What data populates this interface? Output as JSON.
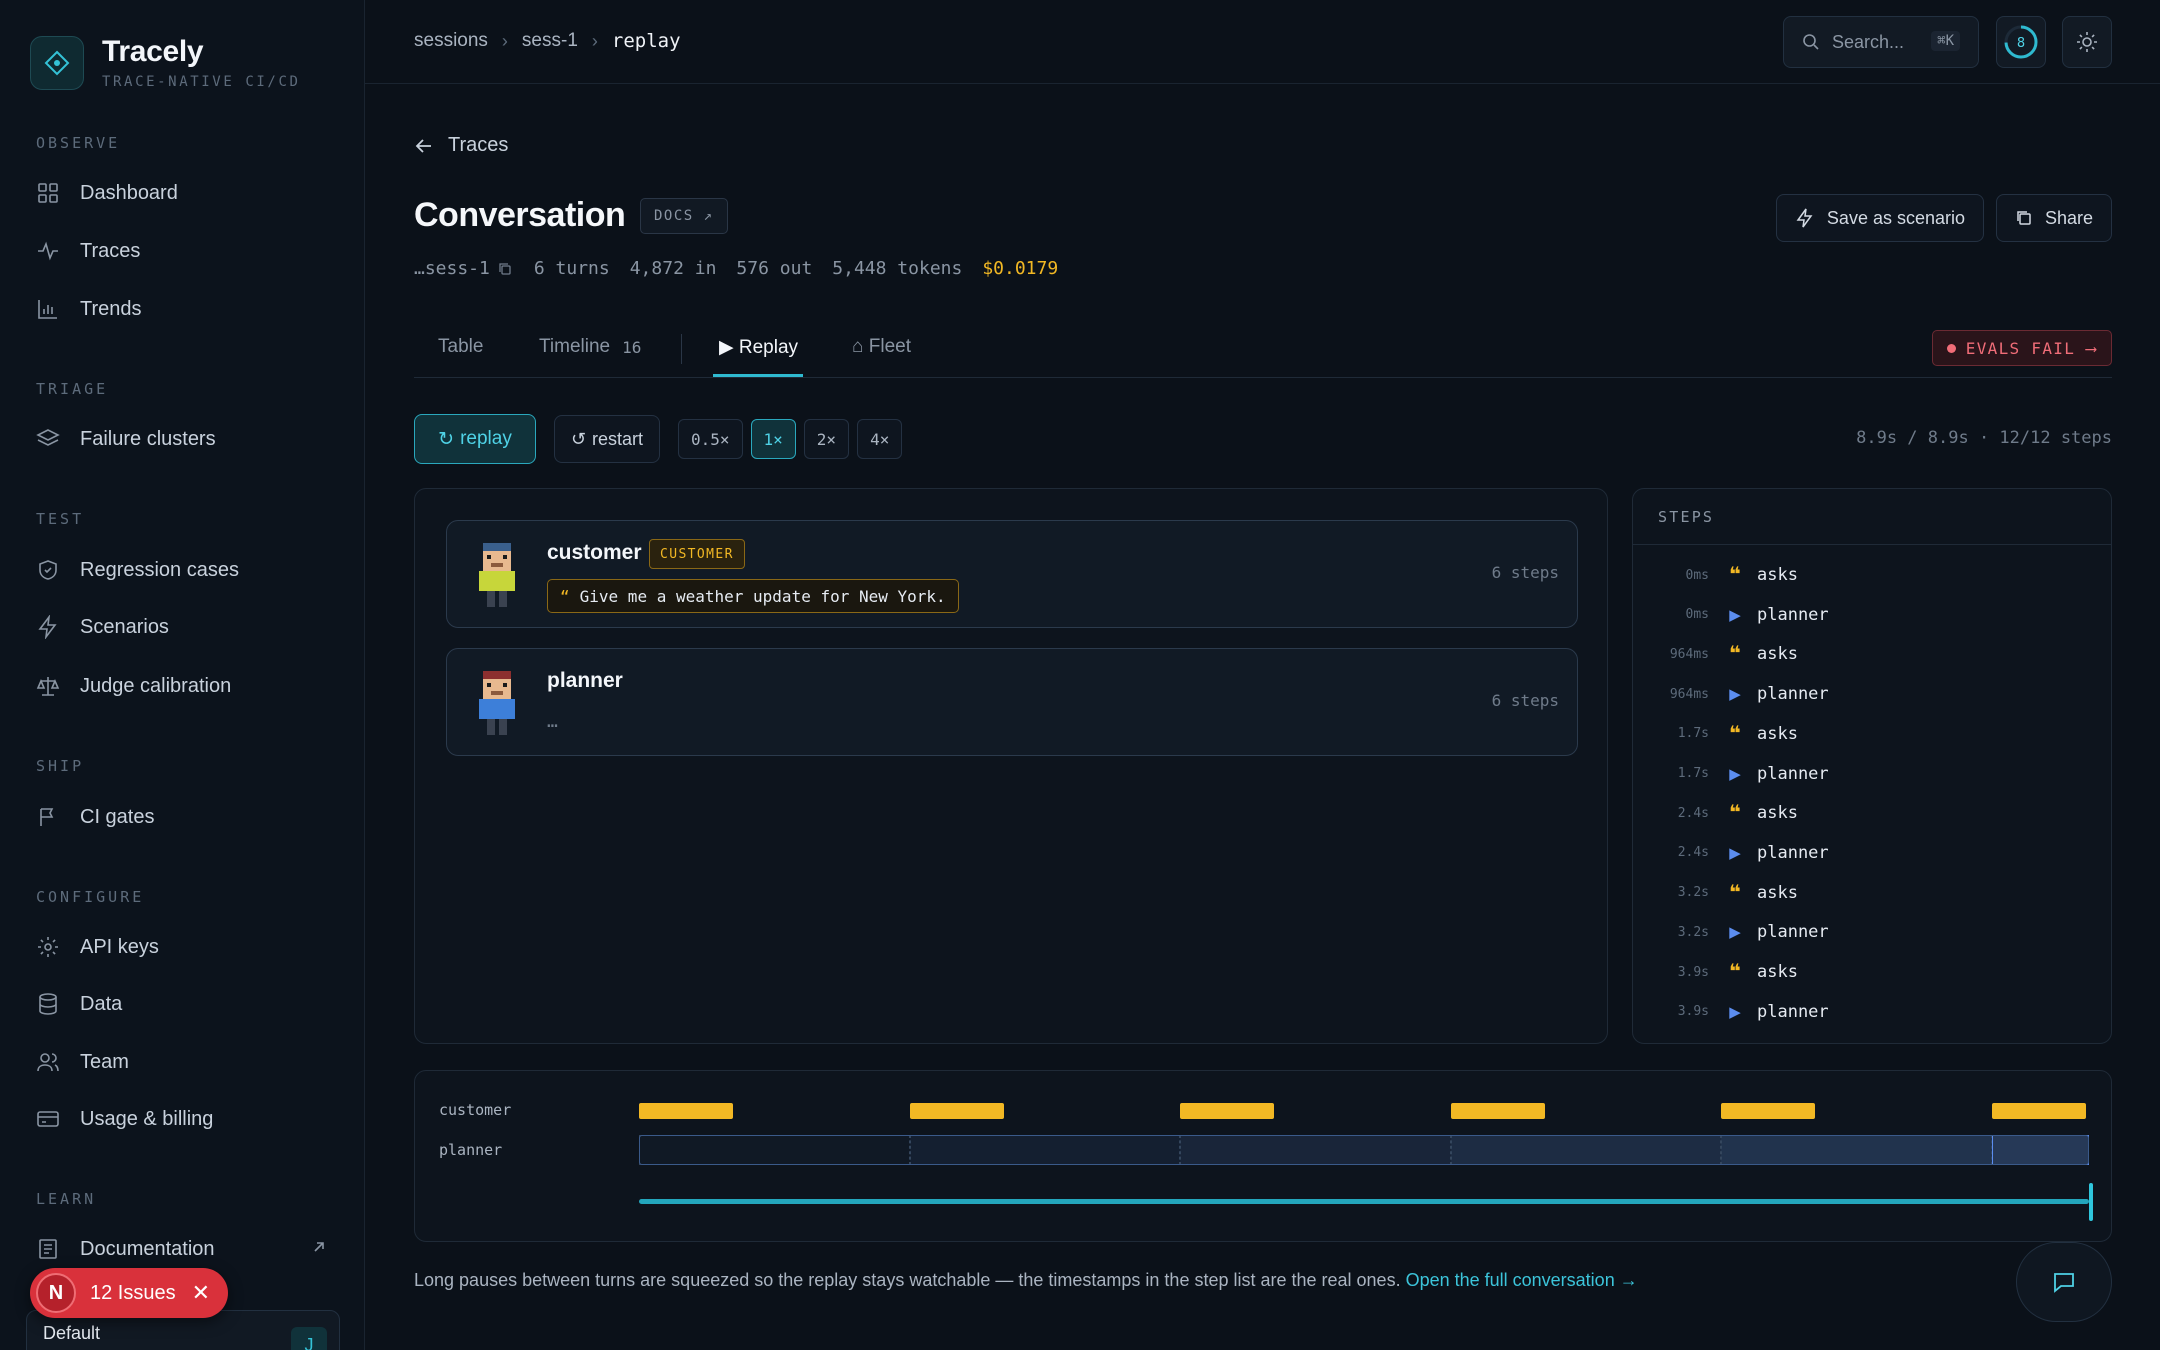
{
  "brand": {
    "name": "Tracely",
    "tagline": "TRACE-NATIVE CI/CD"
  },
  "sidebar": {
    "sections": [
      {
        "label": "OBSERVE",
        "items": [
          {
            "label": "Dashboard",
            "icon": "grid-icon"
          },
          {
            "label": "Traces",
            "icon": "pulse-icon"
          },
          {
            "label": "Trends",
            "icon": "bar-chart-icon"
          }
        ]
      },
      {
        "label": "TRIAGE",
        "items": [
          {
            "label": "Failure clusters",
            "icon": "layers-icon"
          }
        ]
      },
      {
        "label": "TEST",
        "items": [
          {
            "label": "Regression cases",
            "icon": "shield-check-icon"
          },
          {
            "label": "Scenarios",
            "icon": "bolt-icon"
          },
          {
            "label": "Judge calibration",
            "icon": "scale-icon"
          }
        ]
      },
      {
        "label": "SHIP",
        "items": [
          {
            "label": "CI gates",
            "icon": "flag-icon"
          }
        ]
      },
      {
        "label": "CONFIGURE",
        "items": [
          {
            "label": "API keys",
            "icon": "gear-icon"
          },
          {
            "label": "Data",
            "icon": "database-icon"
          },
          {
            "label": "Team",
            "icon": "users-icon"
          },
          {
            "label": "Usage & billing",
            "icon": "card-icon"
          }
        ]
      },
      {
        "label": "LEARN",
        "items": [
          {
            "label": "Documentation",
            "icon": "book-icon"
          }
        ]
      }
    ],
    "issues": {
      "avatar": "N",
      "label": "12 Issues"
    },
    "workspace": {
      "name": "Default",
      "avatar": "J"
    }
  },
  "topbar": {
    "breadcrumb": [
      "sessions",
      "sess-1",
      "replay"
    ],
    "search_placeholder": "Search...",
    "search_shortcut": "⌘K",
    "ring_value": "8"
  },
  "header": {
    "back_label": "Traces",
    "title": "Conversation",
    "docs_label": "DOCS ↗",
    "session_id": "…sess-1",
    "turns": "6 turns",
    "tokens_in": "4,872 in",
    "tokens_out": "576 out",
    "tokens_total": "5,448 tokens",
    "cost": "$0.0179",
    "save_scenario_label": "Save as scenario",
    "share_label": "Share"
  },
  "tabs": [
    {
      "label": "Table"
    },
    {
      "label": "Timeline",
      "count": "16"
    },
    {
      "label": "▶ Replay",
      "active": true
    },
    {
      "label": "⌂ Fleet"
    }
  ],
  "evals_badge": "EVALS FAIL ⟶",
  "controls": {
    "replay_label": "replay",
    "restart_label": "restart",
    "speeds": [
      "0.5×",
      "1×",
      "2×",
      "4×"
    ],
    "active_speed": "1×",
    "progress": "8.9s / 8.9s · 12/12 steps"
  },
  "actors": [
    {
      "name": "customer",
      "tag": "CUSTOMER",
      "message": "Give me a weather update for New York.",
      "steps": "6 steps"
    },
    {
      "name": "planner",
      "message": "…",
      "steps": "6 steps"
    }
  ],
  "steps_panel": {
    "title": "STEPS",
    "rows": [
      {
        "time": "0ms",
        "kind": "asks",
        "label": "asks"
      },
      {
        "time": "0ms",
        "kind": "planner",
        "label": "planner"
      },
      {
        "time": "964ms",
        "kind": "asks",
        "label": "asks"
      },
      {
        "time": "964ms",
        "kind": "planner",
        "label": "planner"
      },
      {
        "time": "1.7s",
        "kind": "asks",
        "label": "asks"
      },
      {
        "time": "1.7s",
        "kind": "planner",
        "label": "planner"
      },
      {
        "time": "2.4s",
        "kind": "asks",
        "label": "asks"
      },
      {
        "time": "2.4s",
        "kind": "planner",
        "label": "planner"
      },
      {
        "time": "3.2s",
        "kind": "asks",
        "label": "asks"
      },
      {
        "time": "3.2s",
        "kind": "planner",
        "label": "planner"
      },
      {
        "time": "3.9s",
        "kind": "asks",
        "label": "asks"
      },
      {
        "time": "3.9s",
        "kind": "planner",
        "label": "planner"
      }
    ]
  },
  "timeline": {
    "lanes": [
      "customer",
      "planner"
    ],
    "colors": {
      "customer": "#f2b824",
      "planner": "#5b8def",
      "accent": "#2fbad0"
    },
    "playhead_fraction": 1.0
  },
  "footnote": {
    "text": "Long pauses between turns are squeezed so the replay stays watchable — the timestamps in the step list are the real ones. ",
    "link": "Open the full conversation →"
  }
}
